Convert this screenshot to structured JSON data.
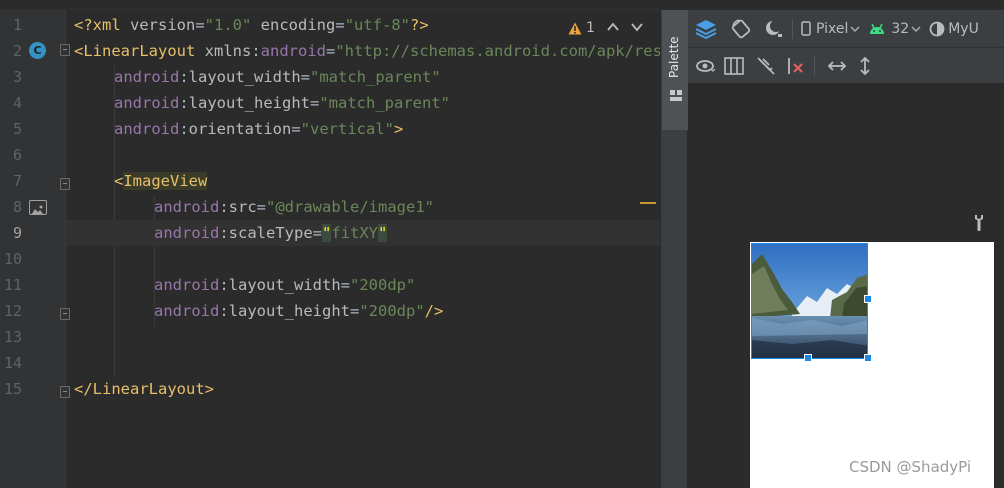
{
  "editor": {
    "line_numbers": [
      "1",
      "2",
      "3",
      "4",
      "5",
      "6",
      "7",
      "8",
      "9",
      "10",
      "11",
      "12",
      "13",
      "14",
      "15"
    ],
    "current_line": 9,
    "inspection": {
      "count": "1",
      "up": "^",
      "down": "v"
    },
    "code": {
      "l1": {
        "open": "<?",
        "name": "xml",
        "a1": " version",
        "eq1": "=",
        "v1": "\"1.0\"",
        "a2": " encoding",
        "eq2": "=",
        "v2": "\"utf-8\"",
        "close": "?>"
      },
      "l2": {
        "open": "<",
        "name": "LinearLayout",
        "a_plain": " xmlns",
        "colon": ":",
        "ns": "android",
        "eq": "=",
        "val": "\"http://schemas.android.com/apk/res/android\""
      },
      "l3": {
        "ns": "android",
        "colon": ":",
        "attr": "layout_width",
        "eq": "=",
        "val": "\"match_parent\""
      },
      "l4": {
        "ns": "android",
        "colon": ":",
        "attr": "layout_height",
        "eq": "=",
        "val": "\"match_parent\""
      },
      "l5": {
        "ns": "android",
        "colon": ":",
        "attr": "orientation",
        "eq": "=",
        "val": "\"vertical\"",
        "close": ">"
      },
      "l7": {
        "open": "<",
        "name": "ImageView"
      },
      "l8": {
        "ns": "android",
        "colon": ":",
        "attr": "src",
        "eq": "=",
        "val": "\"@drawable/image1\""
      },
      "l9": {
        "ns": "android",
        "colon": ":",
        "attr": "scaleType",
        "eq": "=",
        "q_open": "\"",
        "val": "fitXY",
        "q_close": "\""
      },
      "l11": {
        "ns": "android",
        "colon": ":",
        "attr": "layout_width",
        "eq": "=",
        "val": "\"200dp\""
      },
      "l12": {
        "ns": "android",
        "colon": ":",
        "attr": "layout_height",
        "eq": "=",
        "val": "\"200dp\"",
        "close": "/>"
      },
      "l15": {
        "open": "</",
        "name": "LinearLayout",
        "close": ">"
      }
    }
  },
  "palette": {
    "label": "Palette"
  },
  "design_toolbar": {
    "device": "Pixel",
    "api_level": "32",
    "theme": "MyU"
  },
  "watermark": "CSDN @ShadyPi",
  "colors": {
    "accent": "#1e88e5",
    "android_green": "#3ddc84",
    "badge": "#3592c4"
  }
}
